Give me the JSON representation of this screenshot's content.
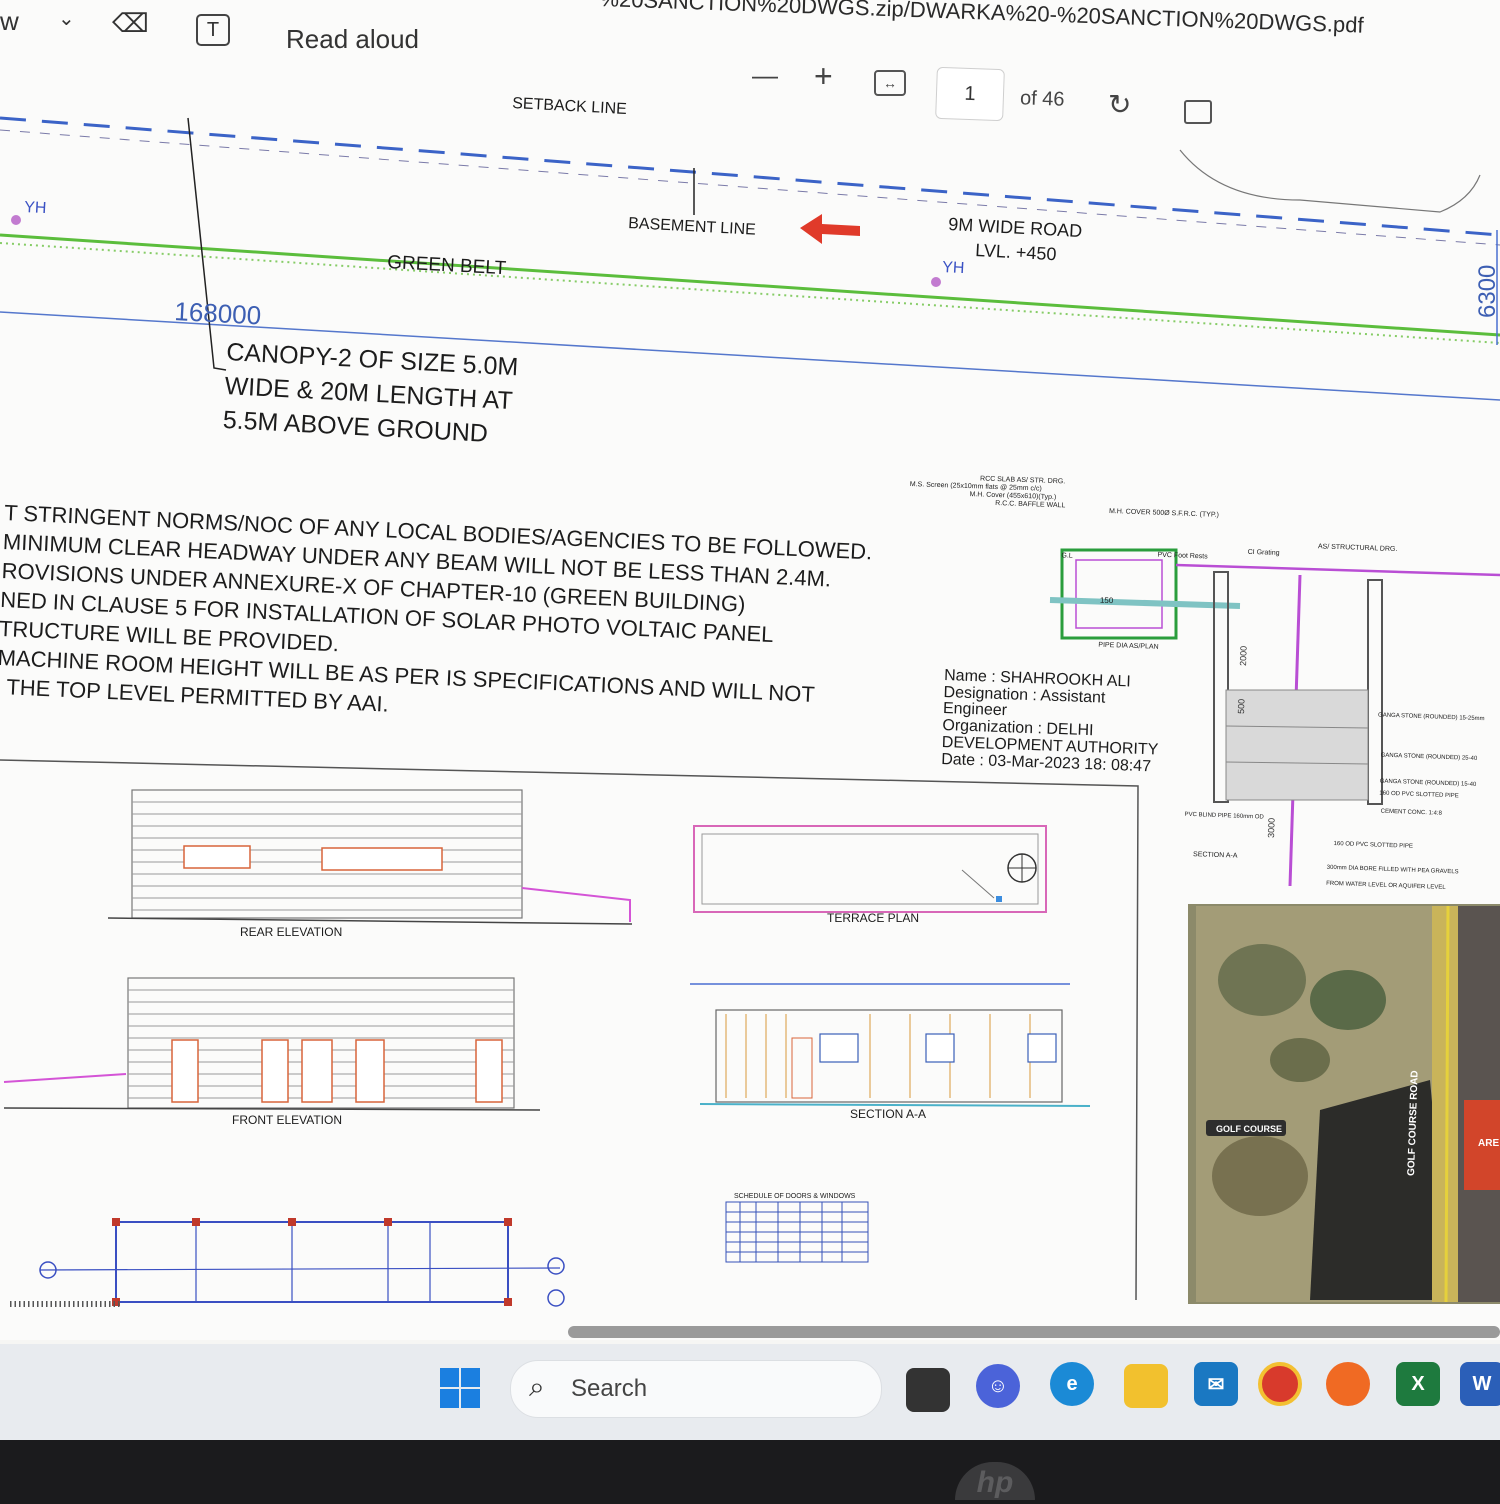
{
  "toolbar": {
    "left_text": "w",
    "read_aloud": "Read aloud",
    "url": "%20SANCTION%20DWGS.zip/DWARKA%20-%20SANCTION%20DWGS.pdf",
    "zoom_out": "—",
    "zoom_in": "+",
    "page_current": "1",
    "page_total": "of 46"
  },
  "drawing": {
    "setback_line": "SETBACK LINE",
    "basement_line": "BASEMENT LINE",
    "road": "9M WIDE ROAD",
    "road_level": "LVL. +450",
    "green_belt": "GREEN BELT",
    "yh_1": "YH",
    "yh_2": "YH",
    "dimension_168000": "168000",
    "dimension_6300": "6300",
    "canopy": [
      "CANOPY-2 OF SIZE 5.0M",
      "WIDE & 20M LENGTH AT",
      "5.5M ABOVE GROUND"
    ],
    "notes": [
      "T STRINGENT NORMS/NOC OF ANY LOCAL BODIES/AGENCIES TO BE FOLLOWED.",
      "MINIMUM CLEAR HEADWAY UNDER ANY BEAM WILL NOT BE LESS THAN 2.4M.",
      "ROVISIONS UNDER ANNEXURE-X OF CHAPTER-10 (GREEN BUILDING)",
      "NED IN CLAUSE 5 FOR INSTALLATION OF SOLAR PHOTO VOLTAIC PANEL",
      "TRUCTURE WILL BE PROVIDED.",
      "MACHINE ROOM HEIGHT WILL BE AS PER IS SPECIFICATIONS AND WILL NOT",
      "THE TOP LEVEL PERMITTED BY AAI."
    ],
    "signature": {
      "name": "Name : SHAHROOKH ALI",
      "designation": "Designation : Assistant",
      "designation_2": "Engineer",
      "organization": "Organization : DELHI",
      "organization_2": "DEVELOPMENT AUTHORITY",
      "date": "Date : 03-Mar-2023 18: 08:47"
    },
    "labels": {
      "rear_elevation": "REAR ELEVATION",
      "front_elevation": "FRONT ELEVATION",
      "terrace_plan": "TERRACE PLAN",
      "section_aa": "SECTION A-A",
      "schedule": "SCHEDULE OF DOORS & WINDOWS"
    },
    "detail": {
      "rcc_slab": "RCC SLAB AS/ STR. DRG.",
      "ms_screen": "M.S. Screen (25x10mm flats @ 25mm c/c)",
      "mh_cover": "M.H. Cover (455x610)(Typ.)",
      "rcc_baffle": "R.C.C. BAFFLE WALL",
      "mh_cover_sfrc": "M.H. COVER 500Ø S.F.R.C. (TYP.)",
      "pvc_foot_rests": "PVC Foot Rests",
      "ci_grating": "CI Grating",
      "as_structural": "AS/ STRUCTURAL DRG.",
      "gl": "G.L",
      "dim_150": "150",
      "dim_2000": "2000",
      "dim_500": "500",
      "dim_3000": "3000",
      "pipe_dia": "PIPE DIA AS/PLAN",
      "ganga_stone_1": "GANGA STONE (ROUNDED) 15-25mm",
      "ganga_stone_2": "GANGA STONE (ROUNDED) 25-40",
      "ganga_stone_3": "GANGA STONE (ROUNDED) 15-40",
      "pvc_slotted": "160 OD PVC SLOTTED PIPE",
      "cement_conc": "CEMENT CONC. 1:4:8",
      "pvc_blind": "PVC BLIND PIPE 160mm OD",
      "section_aa_detail": "SECTION A-A",
      "pvc_slotted_2": "160 OD PVC SLOTTED PIPE",
      "bore": "300mm DIA BORE FILLED WITH PEA GRAVELS",
      "water_level": "FROM WATER LEVEL OR AQUIFER LEVEL"
    },
    "map": {
      "golf_course": "GOLF COURSE",
      "road": "GOLF COURSE ROAD",
      "area": "ARE"
    }
  },
  "taskbar": {
    "search": "Search"
  },
  "bezel": {
    "logo": "hp"
  }
}
